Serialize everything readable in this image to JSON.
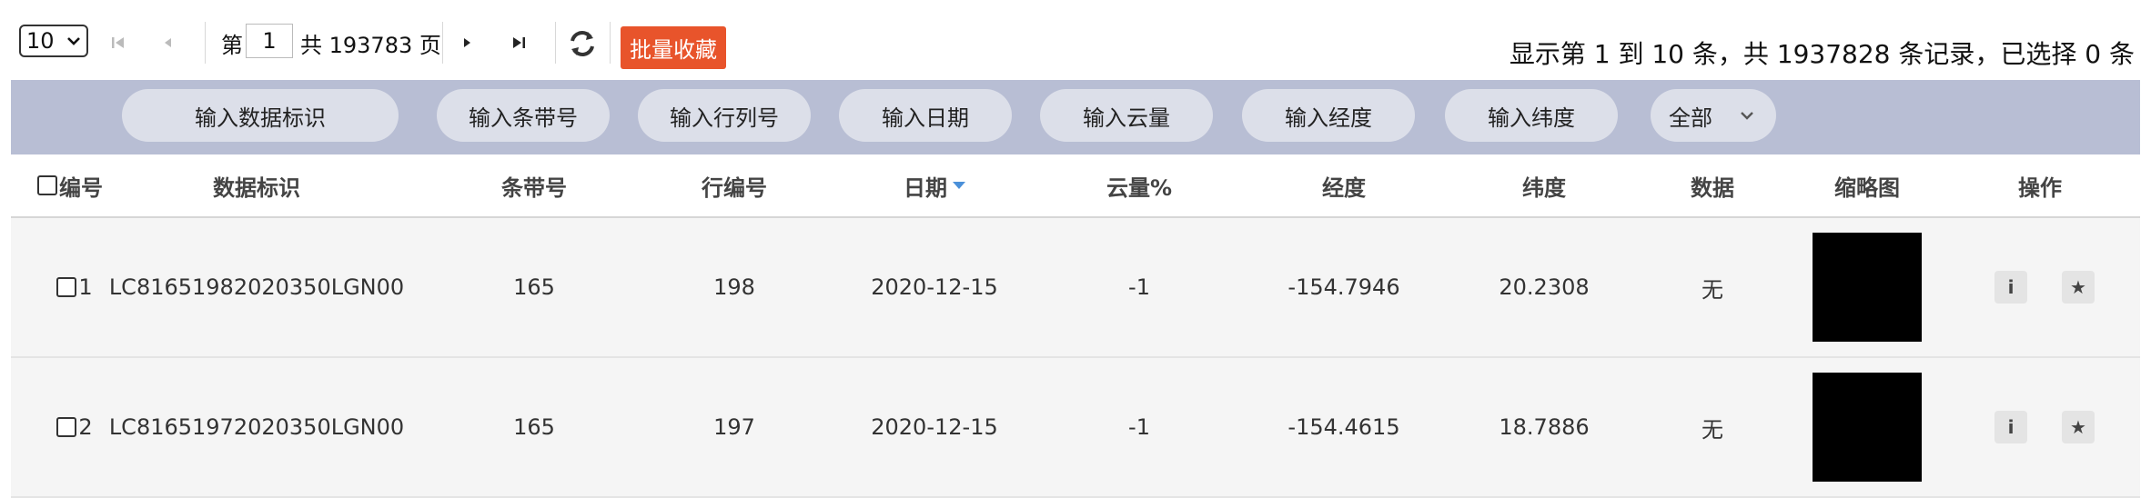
{
  "toolbar": {
    "page_size": "10",
    "page_label_pre": "第",
    "current_page": "1",
    "page_label_mid": "共 193783 页",
    "batch_button": "批量收藏",
    "summary": "显示第 1 到 10 条，共 1937828 条记录，已选择 0 条"
  },
  "filters": {
    "items": [
      "输入数据标识",
      "输入条带号",
      "输入行列号",
      "输入日期",
      "输入云量",
      "输入经度",
      "输入纬度"
    ],
    "select_value": "全部"
  },
  "table": {
    "headers": [
      "编号",
      "数据标识",
      "条带号",
      "行编号",
      "日期",
      "云量%",
      "经度",
      "纬度",
      "数据",
      "缩略图",
      "操作"
    ],
    "sort_color": "#4a90d9",
    "rows": [
      {
        "id": "1",
        "data_id": "LC81651982020350LGN00",
        "path": "165",
        "row": "198",
        "date": "2020-12-15",
        "cloud": "-1",
        "lon": "-154.7946",
        "lat": "20.2308",
        "data": "无"
      },
      {
        "id": "2",
        "data_id": "LC81651972020350LGN00",
        "path": "165",
        "row": "197",
        "date": "2020-12-15",
        "cloud": "-1",
        "lon": "-154.4615",
        "lat": "18.7886",
        "data": "无"
      }
    ],
    "op_info_icon": "i",
    "op_star_icon": "★"
  },
  "colors": {
    "accent_button": "#e8542b",
    "filter_bar": "#b8bed4",
    "row_background": "#f5f5f5"
  }
}
